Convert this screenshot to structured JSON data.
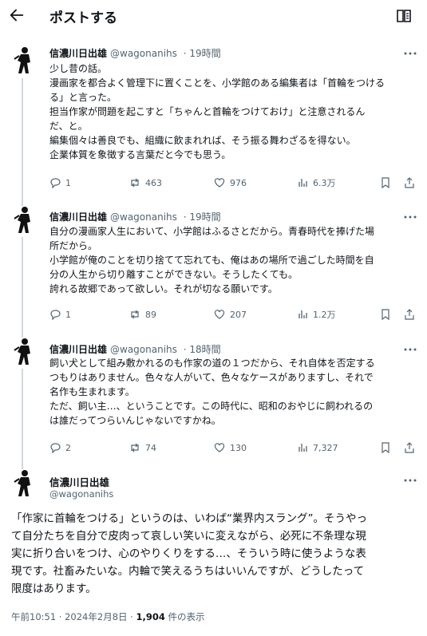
{
  "header": {
    "title": "ポストする"
  },
  "tweets": [
    {
      "name": "信濃川日出雄",
      "handle": "@wagonanihs",
      "time": "19時間",
      "lines": [
        "少し昔の話。",
        "漫画家を都合よく管理下に置くことを、小学館のある編集者は「首輪をつける",
        "る」と言った。",
        "担当作家が問題を起こすと「ちゃんと首輪をつけておけ」と注意されるん",
        "だ、と。",
        "編集個々は善良でも、組織に飲まれれば、そう振る舞わざるを得ない。",
        "企業体質を象徴する言葉だと今でも思う。"
      ],
      "replies": "1",
      "reposts": "463",
      "likes": "976",
      "views": "6.3万"
    },
    {
      "name": "信濃川日出雄",
      "handle": "@wagonanihs",
      "time": "19時間",
      "lines": [
        "自分の漫画家人生において、小学館はふるさとだから。青春時代を捧げた場",
        "所だから。",
        "小学館が俺のことを切り捨てて忘れても、俺はあの場所で過ごした時間を自",
        "分の人生から切り離すことができない。そうしたくても。",
        "誇れる故郷であって欲しい。それが切なる願いです。"
      ],
      "replies": "1",
      "reposts": "89",
      "likes": "207",
      "views": "1.2万"
    },
    {
      "name": "信濃川日出雄",
      "handle": "@wagonanihs",
      "time": "18時間",
      "lines": [
        "飼い犬として組み敷かれるのも作家の道の１つだから、それ自体を否定する",
        "つもりはありません。色々な人がいて、色々なケースがありますし、それで",
        "名作も生まれます。",
        "ただ、飼い主…、ということです。この時代に、昭和のおやじに飼われるの",
        "は誰だってつらいんじゃないですかね。"
      ],
      "replies": "2",
      "reposts": "74",
      "likes": "130",
      "views": "7,327"
    }
  ],
  "main_tweet": {
    "name": "信濃川日出雄",
    "handle": "@wagonanihs",
    "lines": [
      "「作家に首輪をつける」というのは、いわば“業界内スラング”。そうやっ",
      "て自分たちを自分で皮肉って哀しい笑いに変えながら、必死に不条理な現",
      "実に折り合いをつけ、心のやりくりをする…、そういう時に使うような表",
      "現です。社畜みたいな。内輪で笑えるうちはいいんですが、どうしたって",
      "限度はあります。"
    ],
    "timestamp": "午前10:51 · 2024年2月8日 · ",
    "view_count": "1,904",
    "view_suffix": " 件の表示"
  }
}
